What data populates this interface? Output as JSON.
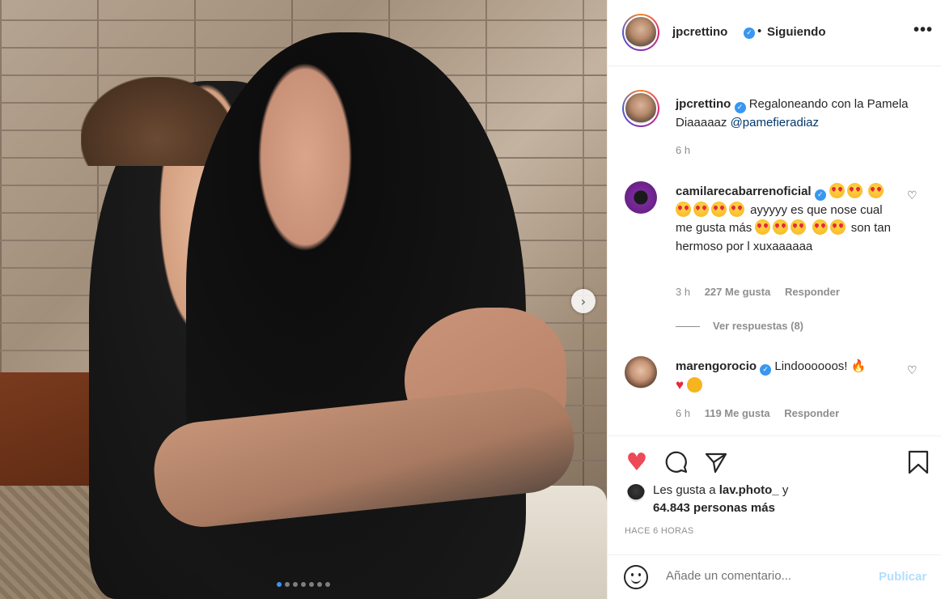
{
  "post": {
    "author": "jpcrettino",
    "follow_status": "Siguiendo",
    "separator": "•",
    "more": "•••",
    "caption_text": "Regaloneando con la Pamela Diaaaaaz",
    "caption_mention": "@pamefieradiaz",
    "caption_time": "6 h",
    "carousel_total_slides": 7,
    "carousel_active_slide": 1
  },
  "comments": [
    {
      "user": "camilarecabarrenoficial",
      "verified": true,
      "text_part1": "ayyyyy es que nose cual me gusta más",
      "text_part2": "son tan hermoso por l xuxaaaaaa",
      "time": "3 h",
      "likes": "227 Me gusta",
      "reply": "Responder",
      "view_replies": "Ver respuestas (8)"
    },
    {
      "user": "marengorocio",
      "verified": true,
      "text": "Lindoooooos!",
      "time": "6 h",
      "likes": "119 Me gusta",
      "reply": "Responder"
    }
  ],
  "likes": {
    "prefix": "Les gusta a",
    "user": "lav.photo_",
    "connector": "y",
    "others": "64.843 personas más"
  },
  "posted_ago": "HACE 6 HORAS",
  "add_comment": {
    "placeholder": "Añade un comentario...",
    "publish": "Publicar"
  },
  "colors": {
    "like_red": "#ed4956",
    "link_blue": "#00376b",
    "verified_blue": "#3897f0",
    "publish_disabled": "#b2dffc"
  }
}
